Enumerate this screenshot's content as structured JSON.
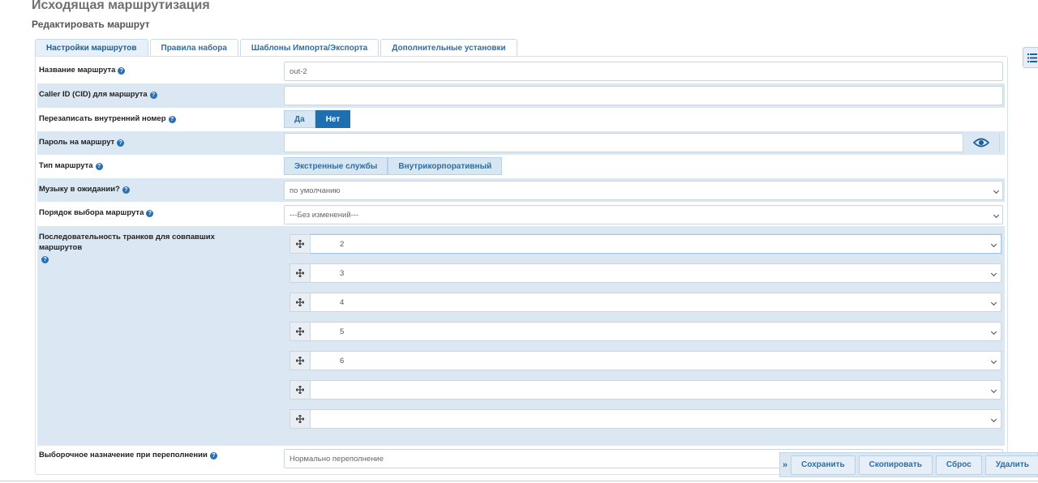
{
  "header": {
    "title": "Исходящая маршрутизация",
    "subtitle": "Редактировать маршрут"
  },
  "tabs": [
    {
      "label": "Настройки маршрутов",
      "active": true
    },
    {
      "label": "Правила набора",
      "active": false
    },
    {
      "label": "Шаблоны Импорта/Экспорта",
      "active": false
    },
    {
      "label": "Дополнительные установки",
      "active": false
    }
  ],
  "form": {
    "route_name": {
      "label": "Название маршрута",
      "value": "out-2"
    },
    "caller_id": {
      "label": "Caller ID (CID) для маршрута",
      "value": ""
    },
    "override_extension": {
      "label": "Перезаписать внутренний номер",
      "options": [
        "Да",
        "Нет"
      ],
      "selected": "Нет"
    },
    "route_password": {
      "label": "Пароль на маршрут",
      "value": ""
    },
    "route_type": {
      "label": "Тип маршрута",
      "options": [
        "Экстренные службы",
        "Внутрикорпоративный"
      ]
    },
    "music_on_hold": {
      "label": "Музыку в ожидании?",
      "value": "по умолчанию"
    },
    "route_position": {
      "label": "Порядок выбора маршрута",
      "value": "---Без изменений---"
    },
    "trunk_sequence": {
      "label": "Последовательность транков для совпавших маршрутов",
      "trunks": [
        "2",
        "3",
        "4",
        "5",
        "6",
        "",
        ""
      ]
    },
    "overflow_destination": {
      "label": "Выборочное назначение при переполнении",
      "value": "Нормально переполнение"
    }
  },
  "actions": {
    "toggle": "»",
    "save": "Сохранить",
    "copy": "Скопировать",
    "reset": "Сброс",
    "delete": "Удалить"
  },
  "icons": {
    "help": "?",
    "drag": "drag-handle-icon",
    "eye": "eye-icon",
    "list": "list-icon"
  },
  "colors": {
    "accent": "#1d6fb0",
    "row_shade": "#dbe8f4",
    "link": "#2c6fa8"
  }
}
